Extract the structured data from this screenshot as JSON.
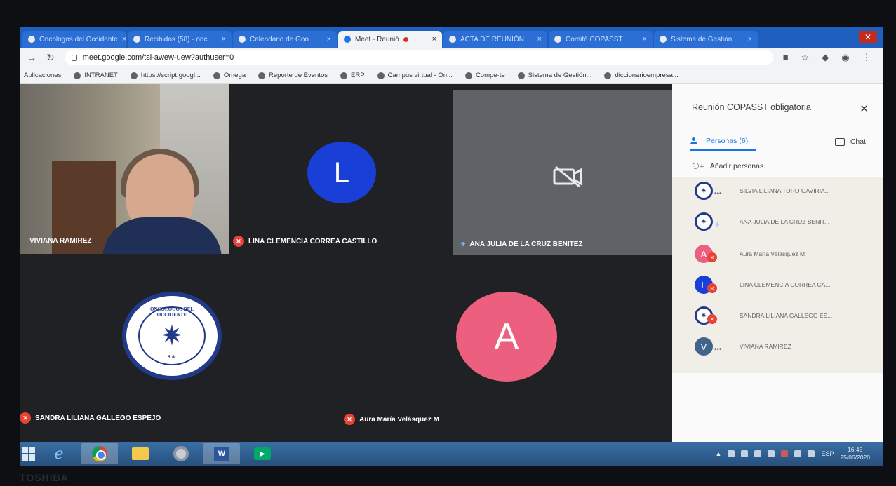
{
  "browser": {
    "tabs": [
      {
        "label": "Oncologos del Occidente",
        "active": false
      },
      {
        "label": "Recibidos (58) - onc",
        "active": false
      },
      {
        "label": "Calendario de Goo",
        "active": false
      },
      {
        "label": "Meet - Reunió",
        "active": true
      },
      {
        "label": "ACTA DE REUNIÓN",
        "active": false
      },
      {
        "label": "Comité COPASST",
        "active": false
      },
      {
        "label": "Sistema de Gestión",
        "active": false
      }
    ],
    "url": "meet.google.com/tsi-awew-uew?authuser=0",
    "bookmarks": [
      "Aplicaciones",
      "INTRANET",
      "https://script.googl...",
      "Omega",
      "Reporte de Eventos",
      "ERP",
      "Campus virtual - On...",
      "Compe·te",
      "Sistema de Gestión...",
      "diccionarioempresa..."
    ]
  },
  "meet": {
    "tiles": {
      "viviana": {
        "name": "VIVIANA RAMIREZ"
      },
      "lina": {
        "name": "LINA CLEMENCIA CORREA CASTILLO",
        "initial": "L",
        "color": "#1a3fd6"
      },
      "ana": {
        "name": "ANA JULIA DE LA CRUZ BENITEZ"
      },
      "sandra": {
        "name": "SANDRA LILIANA GALLEGO ESPEJO"
      },
      "aura": {
        "name": "Aura María Velásquez M",
        "initial": "A",
        "color": "#ec5f7e"
      }
    },
    "logo": {
      "top_text": "ONCOLOGOS DEL OCCIDENTE",
      "bottom_text": "S.A."
    }
  },
  "panel": {
    "title": "Reunión COPASST obligatoria",
    "tab_people": "Personas (6)",
    "tab_chat": "Chat",
    "add_people": "Añadir personas",
    "participants": [
      {
        "name": "SILVIA LILIANA TORO GAVIRIA...",
        "avatar": "logo",
        "status": "dots"
      },
      {
        "name": "ANA JULIA DE LA CRUZ BENIT...",
        "avatar": "logo",
        "status": "speaking"
      },
      {
        "name": "Aura María Velásquez M",
        "avatar": "A",
        "color": "#ec5f7e",
        "status": "muted"
      },
      {
        "name": "LINA CLEMENCIA CORREA CA...",
        "avatar": "L",
        "color": "#1a3fd6",
        "status": "muted"
      },
      {
        "name": "SANDRA LILIANA GALLEGO ES...",
        "avatar": "logo",
        "status": "muted"
      },
      {
        "name": "VIVIANA RAMIREZ",
        "avatar": "V",
        "color": "#41658a",
        "status": "dots"
      }
    ]
  },
  "taskbar": {
    "lang": "ESP",
    "time": "16:45",
    "date": "25/06/2020"
  },
  "bezel": {
    "brand": "TOSHIBA"
  }
}
